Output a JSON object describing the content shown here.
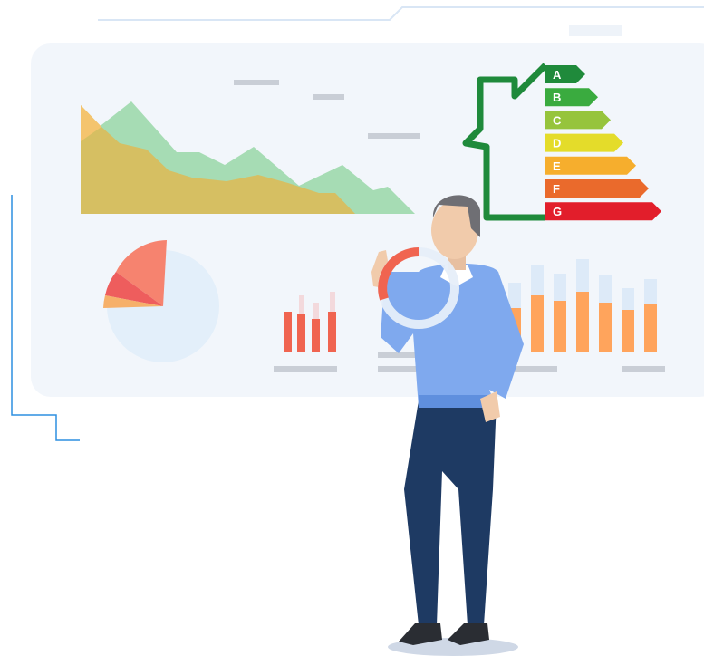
{
  "energy_label": {
    "classes": [
      {
        "letter": "A",
        "color": "#1f8a3b"
      },
      {
        "letter": "B",
        "color": "#3aab3f"
      },
      {
        "letter": "C",
        "color": "#96c43c"
      },
      {
        "letter": "D",
        "color": "#e4dc2a"
      },
      {
        "letter": "E",
        "color": "#f6ae2d"
      },
      {
        "letter": "F",
        "color": "#ea6a2c"
      },
      {
        "letter": "G",
        "color": "#e21e2b"
      }
    ],
    "house_color": "#1f8a3b"
  },
  "colors": {
    "panel_bg": "#f2f6fb",
    "area_back": "#a6dcb4",
    "area_front": "#d6bf62",
    "accent_orange": "#ffa45c",
    "accent_red": "#f06450",
    "placeholder_bar": "#c9ced6",
    "figure_shirt": "#7fa9ee",
    "figure_pants": "#1e3a63"
  }
}
